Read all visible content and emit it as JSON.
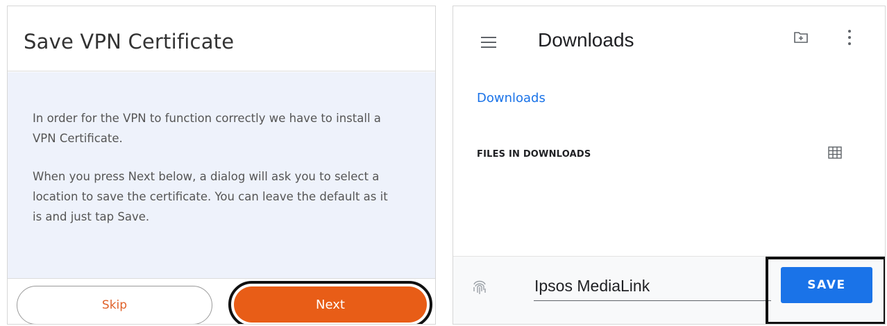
{
  "left_dialog": {
    "title": "Save VPN Certificate",
    "paragraph1": "In order for the VPN to function correctly we have to install a VPN Certificate.",
    "paragraph2": "When you press Next below, a dialog will ask you to select a location to save the certificate. You can leave the default as it is and just tap Save.",
    "skip_label": "Skip",
    "next_label": "Next",
    "accent_color": "#e85d17"
  },
  "file_picker": {
    "title": "Downloads",
    "breadcrumb": "Downloads",
    "section_label": "FILES IN DOWNLOADS",
    "filename_value": "Ipsos MediaLink",
    "save_label": "SAVE",
    "icons": [
      "menu-icon",
      "new-folder-icon",
      "more-vert-icon",
      "grid-view-icon",
      "fingerprint-icon"
    ],
    "accent_color": "#1a73e8"
  }
}
